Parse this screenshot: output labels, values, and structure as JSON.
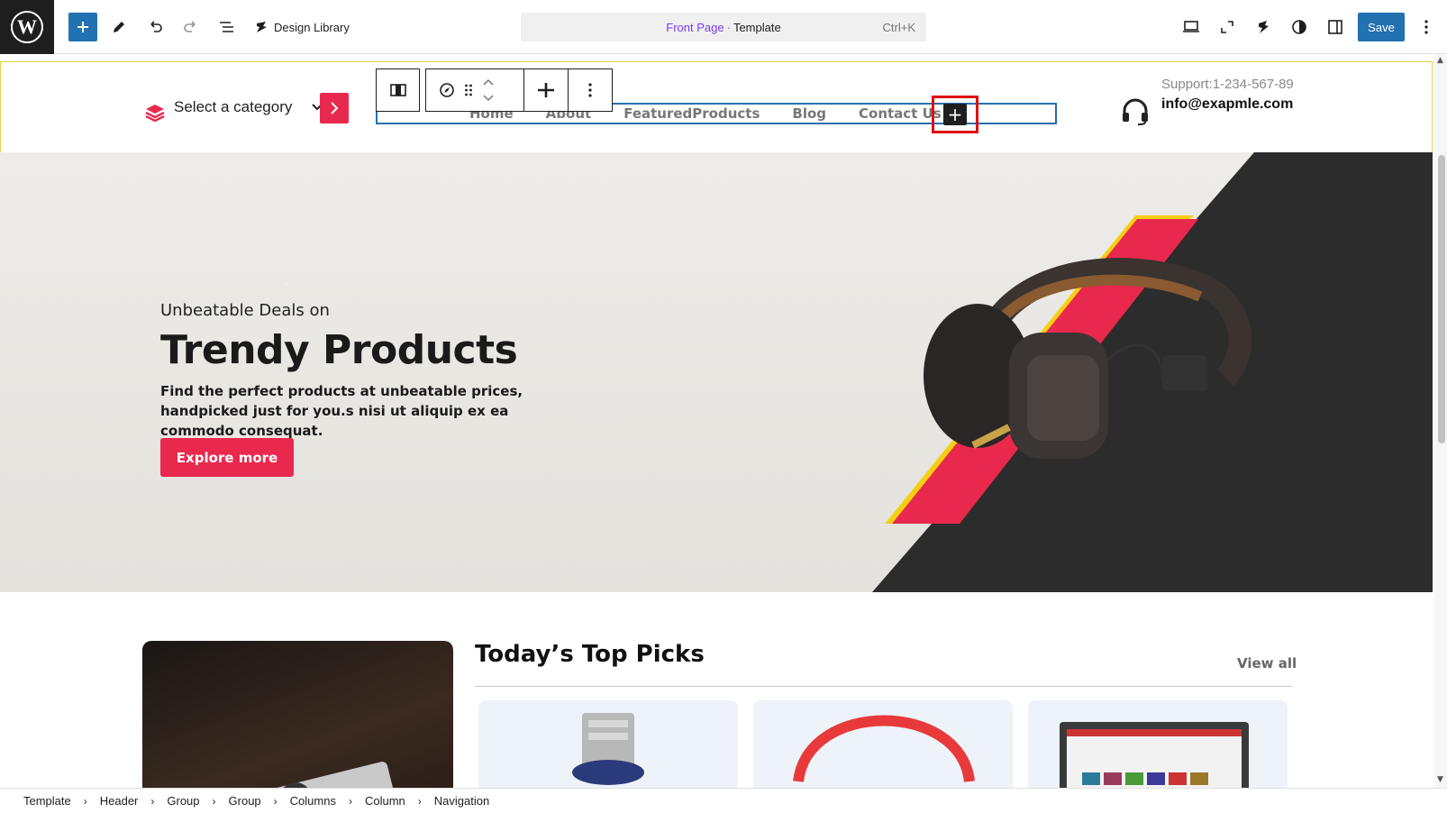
{
  "toolbar": {
    "design_library_label": "Design Library",
    "command_page": "Front Page",
    "command_separator": "·",
    "command_type": "Template",
    "command_shortcut": "Ctrl+K",
    "save_label": "Save"
  },
  "header": {
    "category_label": "Select a category",
    "nav_items": [
      "Home",
      "About",
      "FeaturedProducts",
      "Blog",
      "Contact Us"
    ],
    "nav_add_label": "+",
    "support_phone": "Support:1-234-567-89",
    "support_email": "info@exapmle.com"
  },
  "hero": {
    "subtitle": "Unbeatable Deals on",
    "title": "Trendy Products",
    "description": "Find the perfect products at unbeatable prices, handpicked just for you.s nisi ut aliquip ex ea commodo consequat.",
    "button_label": "Explore more"
  },
  "section": {
    "title": "Today’s Top Picks",
    "view_all": "View all"
  },
  "breadcrumb": [
    "Template",
    "Header",
    "Group",
    "Group",
    "Columns",
    "Column",
    "Navigation"
  ],
  "colors": {
    "accent": "#e8294d",
    "wp_blue": "#2271b1",
    "command_page": "#7c3aed",
    "selection_outline": "#e01010"
  }
}
